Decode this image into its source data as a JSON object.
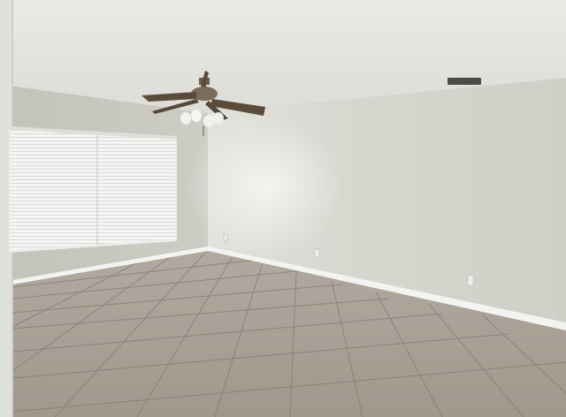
{
  "scene": {
    "description_tags": [
      "empty-room",
      "tile-floor",
      "ceiling-fan",
      "window-blinds"
    ],
    "colors": {
      "ceiling": "#e6e6e3",
      "wall_left": "#c9c9c0",
      "wall_back": "#d6d6cf",
      "floor": "#a89f95",
      "grout": "#7f776e",
      "baseboard": "#f2f2ef",
      "blinds": "#f4f4f2",
      "fan_body": "#6b5f4e"
    }
  },
  "watermark": {
    "text": ""
  }
}
